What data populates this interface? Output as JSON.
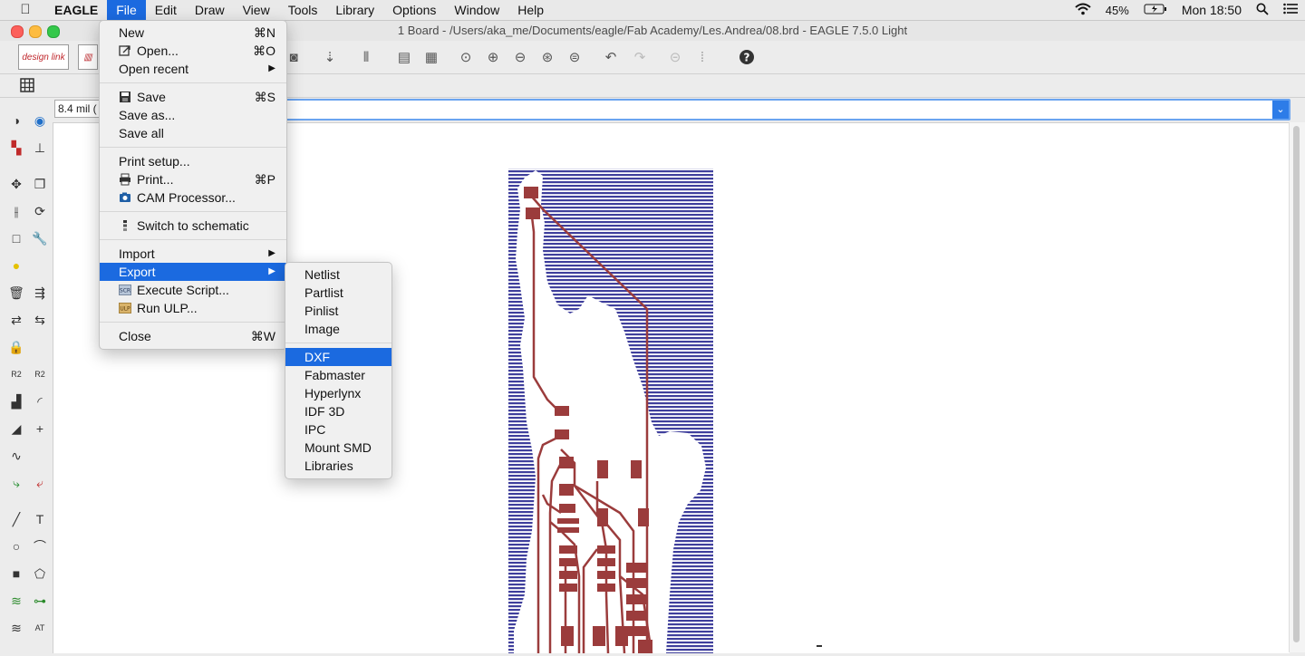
{
  "menubar": {
    "app_name": "EAGLE",
    "items": [
      "File",
      "Edit",
      "Draw",
      "View",
      "Tools",
      "Library",
      "Options",
      "Window",
      "Help"
    ],
    "battery": "45%",
    "clock": "Mon 18:50"
  },
  "window": {
    "title": "1 Board - /Users/aka_me/Documents/eagle/Fab Academy/Les.Andrea/08.brd - EAGLE 7.5.0 Light"
  },
  "toolbar": {
    "grid_value": "8.4 mil (",
    "logo1": "design link"
  },
  "file_menu": {
    "new": {
      "label": "New",
      "shortcut": "⌘N"
    },
    "open": {
      "label": "Open...",
      "shortcut": "⌘O"
    },
    "open_recent": {
      "label": "Open recent"
    },
    "save": {
      "label": "Save",
      "shortcut": "⌘S"
    },
    "save_as": {
      "label": "Save as..."
    },
    "save_all": {
      "label": "Save all"
    },
    "print_setup": {
      "label": "Print setup..."
    },
    "print": {
      "label": "Print...",
      "shortcut": "⌘P"
    },
    "cam": {
      "label": "CAM Processor..."
    },
    "switch": {
      "label": "Switch to schematic"
    },
    "import": {
      "label": "Import"
    },
    "export": {
      "label": "Export"
    },
    "execute": {
      "label": "Execute Script..."
    },
    "run_ulp": {
      "label": "Run ULP..."
    },
    "close": {
      "label": "Close",
      "shortcut": "⌘W"
    }
  },
  "export_submenu": {
    "items": [
      "Netlist",
      "Partlist",
      "Pinlist",
      "Image",
      "DXF",
      "Fabmaster",
      "Hyperlynx",
      "IDF 3D",
      "IPC",
      "Mount SMD",
      "Libraries"
    ],
    "highlighted": "DXF"
  },
  "colors": {
    "accent": "#1b6ae0",
    "copper_pour": "#3f3f9c",
    "traces": "#9b3c3c"
  }
}
